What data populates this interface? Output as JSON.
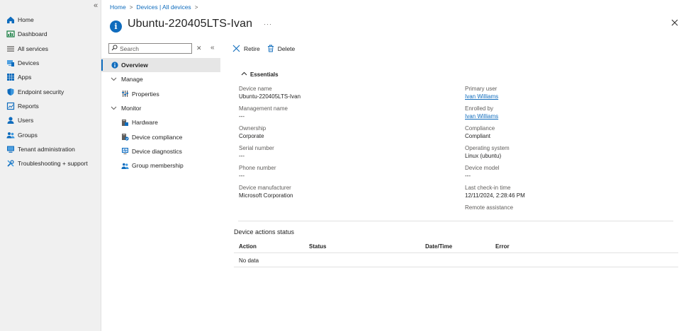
{
  "leftnav": {
    "items": [
      {
        "label": "Home",
        "icon": "home-icon"
      },
      {
        "label": "Dashboard",
        "icon": "dashboard-icon"
      },
      {
        "label": "All services",
        "icon": "all-services-icon"
      },
      {
        "label": "Devices",
        "icon": "devices-icon"
      },
      {
        "label": "Apps",
        "icon": "apps-icon"
      },
      {
        "label": "Endpoint security",
        "icon": "shield-icon"
      },
      {
        "label": "Reports",
        "icon": "reports-icon"
      },
      {
        "label": "Users",
        "icon": "user-icon"
      },
      {
        "label": "Groups",
        "icon": "groups-icon"
      },
      {
        "label": "Tenant administration",
        "icon": "tenant-admin-icon"
      },
      {
        "label": "Troubleshooting + support",
        "icon": "wrench-icon"
      }
    ]
  },
  "breadcrumb": {
    "home": "Home",
    "devices": "Devices | All devices"
  },
  "title": "Ubuntu-220405LTS-Ivan",
  "resource_menu": {
    "search_placeholder": "Search",
    "items": [
      {
        "label": "Overview",
        "selected": true
      },
      {
        "label": "Manage",
        "group": true
      },
      {
        "label": "Properties"
      },
      {
        "label": "Monitor",
        "group": true
      },
      {
        "label": "Hardware"
      },
      {
        "label": "Device compliance"
      },
      {
        "label": "Device diagnostics"
      },
      {
        "label": "Group membership"
      }
    ]
  },
  "toolbar": {
    "retire": "Retire",
    "delete": "Delete"
  },
  "essentials": {
    "header": "Essentials",
    "left": [
      {
        "key": "Device name",
        "value": "Ubuntu-220405LTS-Ivan"
      },
      {
        "key": "Management name",
        "value": "---"
      },
      {
        "key": "Ownership",
        "value": "Corporate"
      },
      {
        "key": "Serial number",
        "value": "---"
      },
      {
        "key": "Phone number",
        "value": "---"
      },
      {
        "key": "Device manufacturer",
        "value": "Microsoft Corporation"
      }
    ],
    "right": [
      {
        "key": "Primary user",
        "value": "Ivan Williams",
        "link": true
      },
      {
        "key": "Enrolled by",
        "value": "Ivan Williams",
        "link": true
      },
      {
        "key": "Compliance",
        "value": "Compliant"
      },
      {
        "key": "Operating system",
        "value": "Linux (ubuntu)"
      },
      {
        "key": "Device model",
        "value": "---"
      },
      {
        "key": "Last check-in time",
        "value": "12/11/2024, 2:28:46 PM"
      },
      {
        "key": "Remote assistance",
        "value": ""
      }
    ]
  },
  "device_actions": {
    "title": "Device actions status",
    "columns": [
      "Action",
      "Status",
      "Date/Time",
      "Error"
    ],
    "empty": "No data"
  },
  "colors": {
    "accent": "#0f6cbd",
    "nav_bg": "#f0f0f0",
    "selected_bg": "#e6e6e6"
  }
}
